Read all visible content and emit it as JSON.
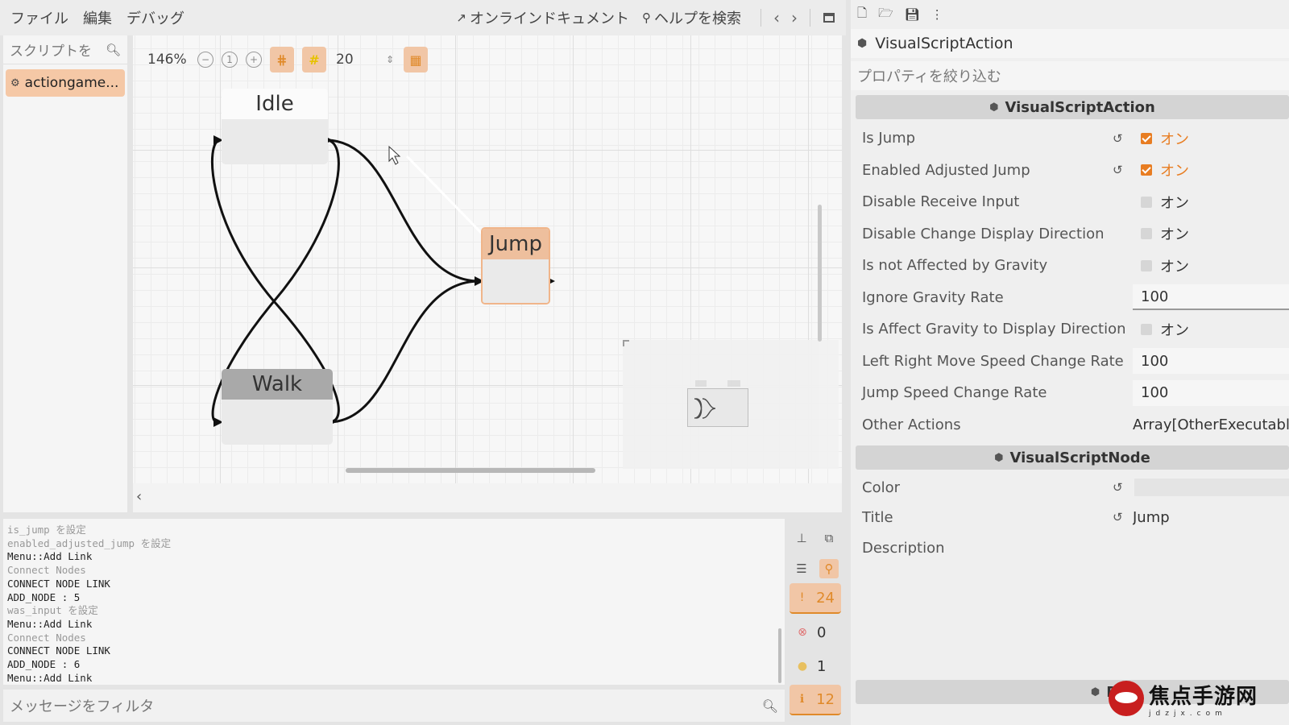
{
  "menu": {
    "items": [
      "ファイル",
      "編集",
      "デバッグ"
    ],
    "online_docs": "オンラインドキュメント",
    "help_search": "ヘルプを検索"
  },
  "script_panel": {
    "search_placeholder": "スクリプトを",
    "items": [
      "actiongame..."
    ]
  },
  "graph": {
    "zoom": "146%",
    "snap_step": "20",
    "nodes": {
      "idle": "Idle",
      "walk": "Walk",
      "jump": "Jump"
    }
  },
  "output": {
    "lines": [
      {
        "text": "is_jump を設定",
        "dim": true
      },
      {
        "text": "enabled_adjusted_jump を設定",
        "dim": true
      },
      {
        "text": "Menu::Add Link",
        "dim": false
      },
      {
        "text": "Connect Nodes",
        "dim": true
      },
      {
        "text": "CONNECT NODE LINK",
        "dim": false
      },
      {
        "text": "ADD_NODE : 5",
        "dim": false
      },
      {
        "text": "was_input を設定",
        "dim": true
      },
      {
        "text": "Menu::Add Link",
        "dim": false
      },
      {
        "text": "Connect Nodes",
        "dim": true
      },
      {
        "text": "CONNECT NODE LINK",
        "dim": false
      },
      {
        "text": "ADD_NODE : 6",
        "dim": false
      },
      {
        "text": "Menu::Add Link",
        "dim": false
      }
    ],
    "filter_placeholder": "メッセージをフィルタ",
    "counts": {
      "messages": "24",
      "errors": "0",
      "warnings": "1",
      "info": "12"
    }
  },
  "inspector": {
    "object_name": "VisualScriptAction",
    "filter_placeholder": "プロパティを絞り込む",
    "section_action": "VisualScriptAction",
    "section_node": "VisualScriptNode",
    "section_bottom": "Res",
    "on_label": "オン",
    "props": {
      "is_jump": "Is Jump",
      "enabled_adjusted_jump": "Enabled Adjusted Jump",
      "disable_receive_input": "Disable Receive Input",
      "disable_change_display_direction": "Disable Change Display Direction",
      "not_affected_by_gravity": "Is not Affected by Gravity",
      "ignore_gravity_rate": "Ignore Gravity Rate",
      "affect_gravity_display": "Is Affect Gravity to Display Direction",
      "lr_move_speed_rate": "Left Right Move Speed Change Rate",
      "jump_speed_rate": "Jump Speed Change Rate",
      "other_actions": "Other Actions",
      "color": "Color",
      "title": "Title",
      "description": "Description"
    },
    "values": {
      "is_jump": true,
      "enabled_adjusted_jump": true,
      "disable_receive_input": false,
      "disable_change_display_direction": false,
      "not_affected_by_gravity": false,
      "ignore_gravity_rate": "100",
      "affect_gravity_display": false,
      "lr_move_speed_rate": "100",
      "jump_speed_rate": "100",
      "other_actions": "Array[OtherExecutable",
      "title": "Jump"
    }
  },
  "watermark": {
    "text": "焦点手游网",
    "sub": "jdzjx.com"
  },
  "colors": {
    "accent": "#e87d22",
    "selection": "#f5c8a6"
  }
}
